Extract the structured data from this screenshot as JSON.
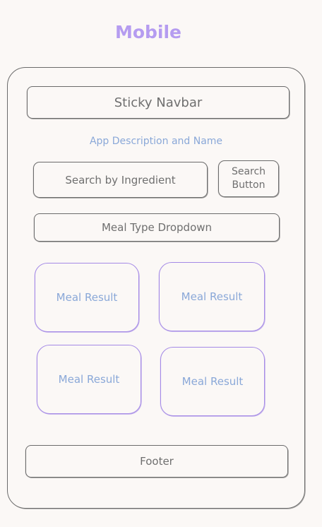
{
  "title": "Mobile",
  "navbar": {
    "label": "Sticky Navbar"
  },
  "app_description": "App Description and Name",
  "search": {
    "input_label": "Search by Ingredient",
    "button_line1": "Search",
    "button_line2": "Button"
  },
  "dropdown": {
    "label": "Meal Type Dropdown"
  },
  "meals": [
    {
      "label": "Meal Result"
    },
    {
      "label": "Meal Result"
    },
    {
      "label": "Meal Result"
    },
    {
      "label": "Meal Result"
    }
  ],
  "footer": {
    "label": "Footer"
  },
  "colors": {
    "title": "#b59cf0",
    "outline": "#6b6b6b",
    "card_border": "#a48ae6",
    "accent_text": "#8aa8d8",
    "background": "#fbf8f6"
  }
}
